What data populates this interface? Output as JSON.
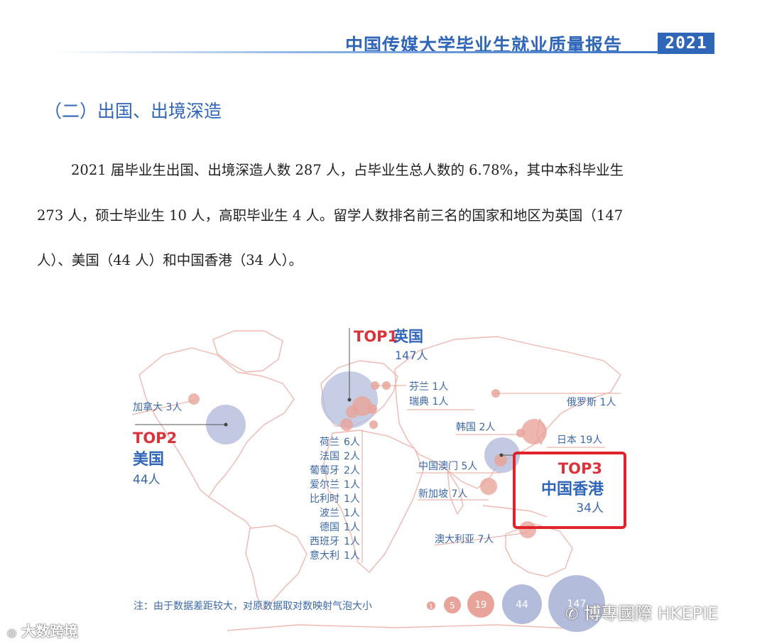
{
  "header": {
    "title": "中国传媒大学毕业生就业质量报告",
    "year": "2021"
  },
  "section": {
    "title": "（二）出国、出境深造"
  },
  "body": {
    "line1": "2021 届毕业生出国、出境深造人数 287 人，占毕业生总人数的 6.78%，其中本科毕业生",
    "line2": "273 人，硕士毕业生 10 人，高职毕业生 4 人。留学人数排名前三名的国家和地区为英国（147",
    "line3": "人）、美国（44 人）和中国香港（34 人）。"
  },
  "map": {
    "top1": {
      "rank": "TOP1",
      "name": "英国",
      "count": "147人"
    },
    "top2": {
      "rank": "TOP2",
      "name": "美国",
      "count": "44人"
    },
    "top3": {
      "rank": "TOP3",
      "name": "中国香港",
      "count": "34人"
    },
    "labels": {
      "canada": "加拿大 3人",
      "finland": "芬兰 1人",
      "sweden": "瑞典 1人",
      "russia": "俄罗斯 1人",
      "korea": "韩国 2人",
      "japan": "日本 19人",
      "macau": "中国澳门 5人",
      "singapore": "新加坡 7人",
      "australia": "澳大利亚 7人"
    },
    "europe_list": [
      {
        "name": "荷兰",
        "count": "6人"
      },
      {
        "name": "法国",
        "count": "2人"
      },
      {
        "name": "葡萄牙",
        "count": "2人"
      },
      {
        "name": "爱尔兰",
        "count": "1人"
      },
      {
        "name": "比利时",
        "count": "1人"
      },
      {
        "name": "波兰",
        "count": "1人"
      },
      {
        "name": "德国",
        "count": "1人"
      },
      {
        "name": "西班牙",
        "count": "1人"
      },
      {
        "name": "意大利",
        "count": "1人"
      }
    ],
    "legend": {
      "note": "注：由于数据差距较大，对原数据取对数映射气泡大小",
      "bubbles": [
        "1",
        "5",
        "19",
        "44",
        "147"
      ]
    }
  },
  "watermarks": {
    "left": "大数跨境",
    "right": "博專國際 HKEPIE"
  },
  "colors": {
    "brand_blue": "#2f66b8",
    "accent_red": "#d9343c",
    "bubble_red": "#e8a49a",
    "bubble_blue": "#b4bcdc"
  }
}
